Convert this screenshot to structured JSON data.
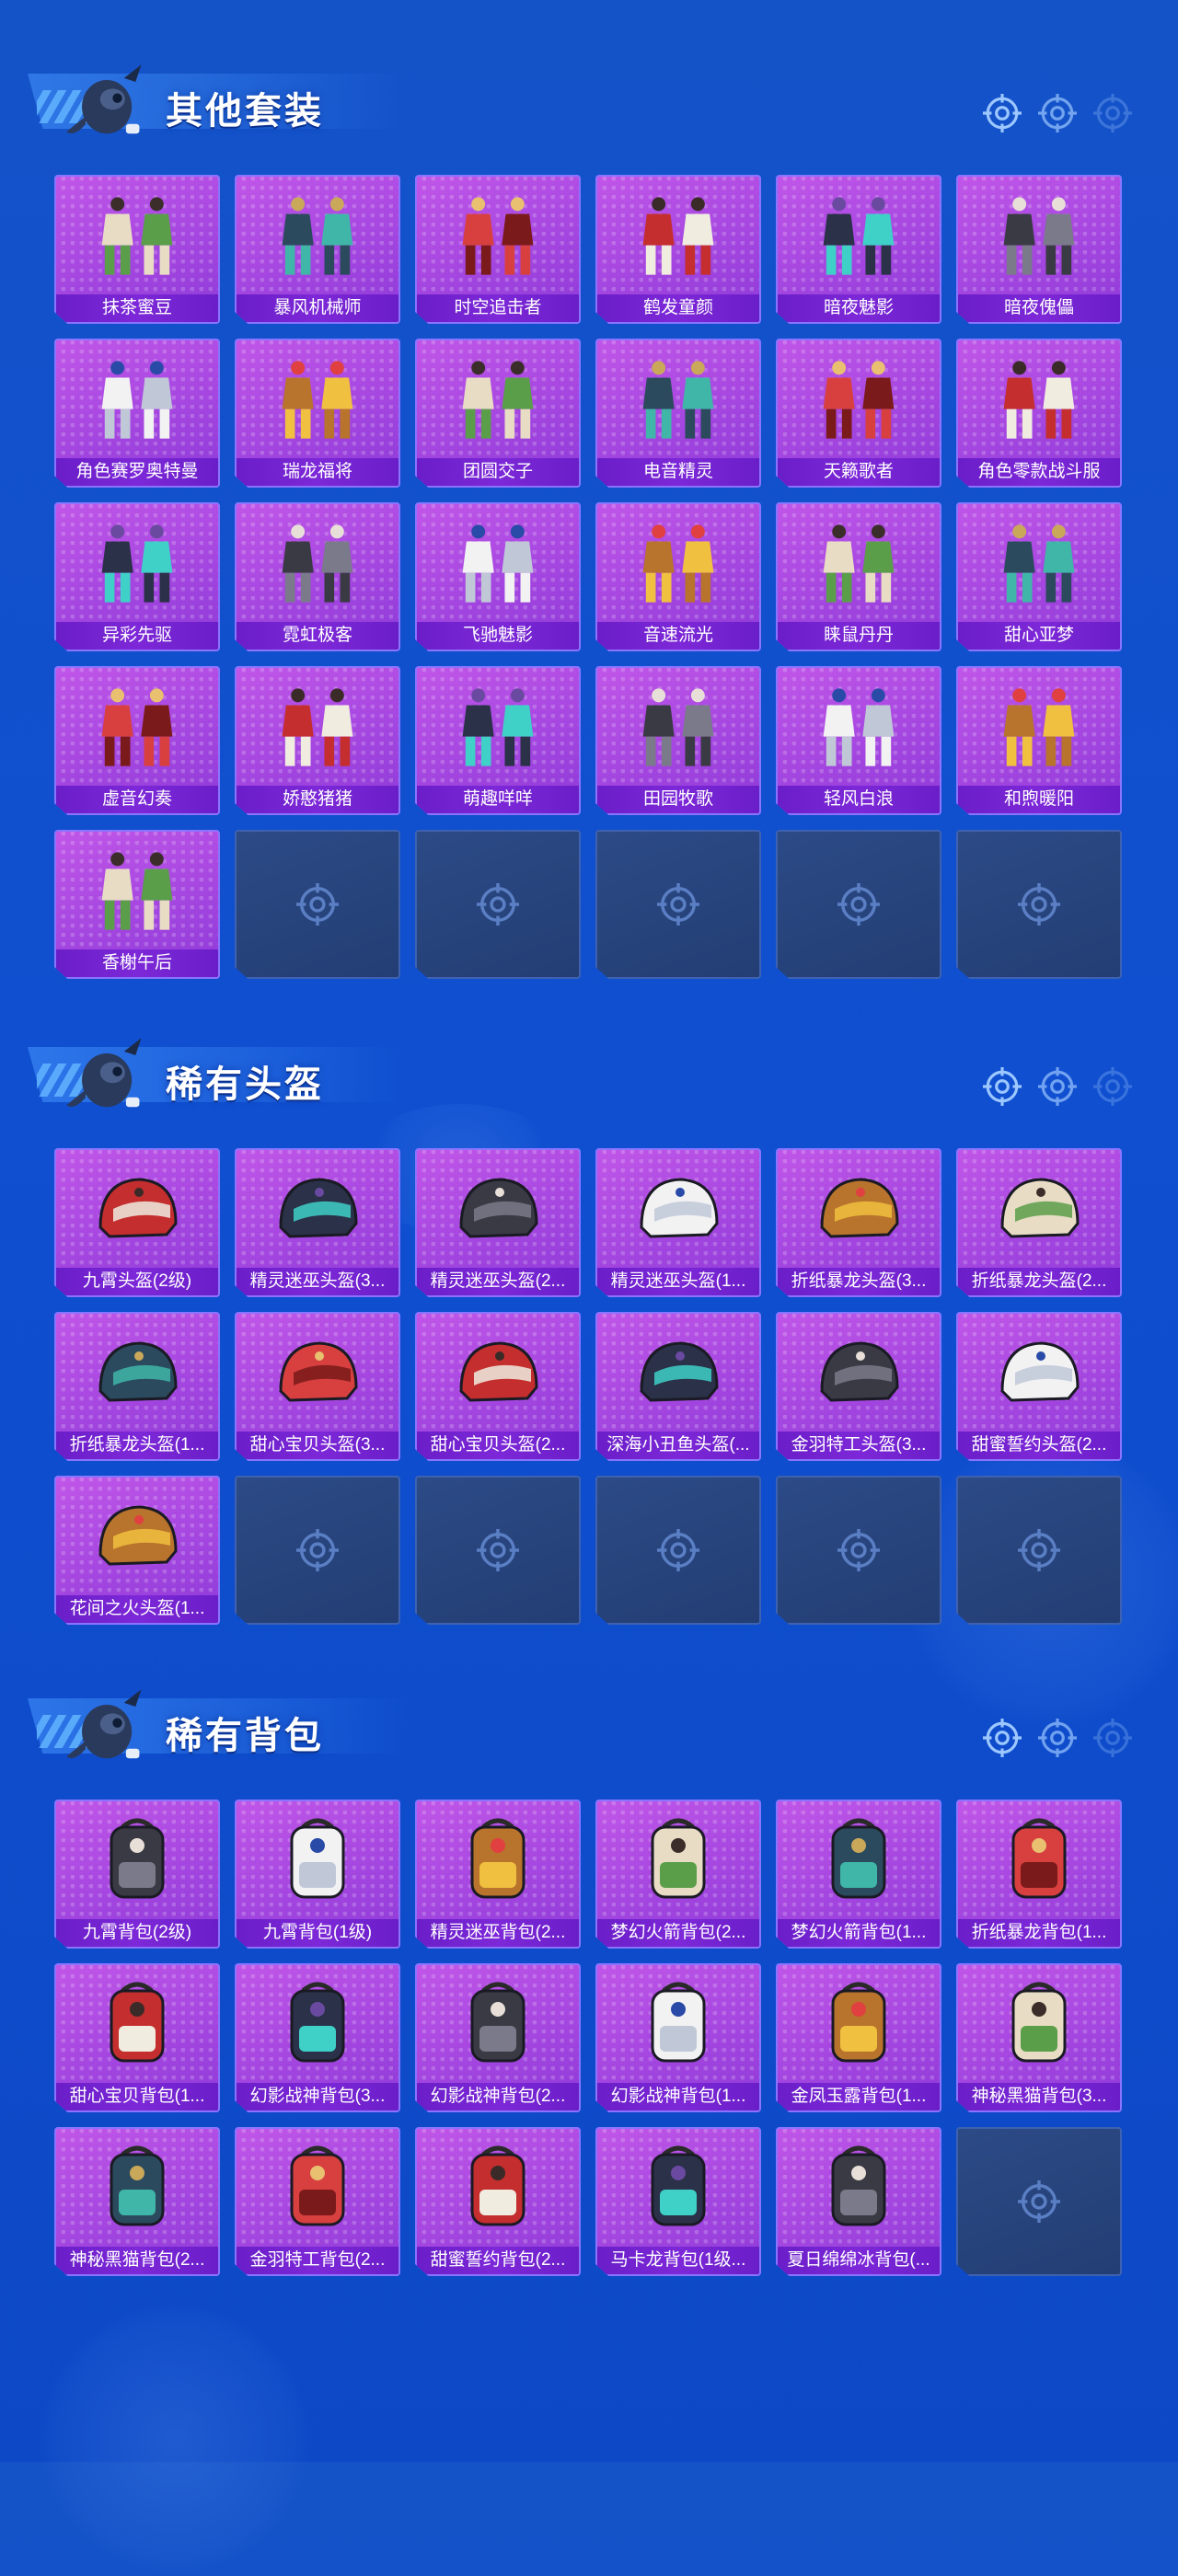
{
  "colors": {
    "background": "#1250cc",
    "card_purple": "#a446e0",
    "card_label": "#6a1ec8",
    "empty_slot": "#233e74"
  },
  "sections": [
    {
      "title": "其他套装",
      "item_icon": "outfit-icon",
      "items": [
        "抹茶蜜豆",
        "暴风机械师",
        "时空追击者",
        "鹤发童颜",
        "暗夜魅影",
        "暗夜傀儡",
        "角色赛罗奥特曼",
        "瑞龙福将",
        "团圆交子",
        "电音精灵",
        "天籁歌者",
        "角色零款战斗服",
        "异彩先驱",
        "霓虹极客",
        "飞驰魅影",
        "音速流光",
        "睐鼠丹丹",
        "甜心亚梦",
        "虚音幻奏",
        "娇憨猪猪",
        "萌趣咩咩",
        "田园牧歌",
        "轻风白浪",
        "和煦暖阳",
        "香榭午后"
      ],
      "empty_slots": 5
    },
    {
      "title": "稀有头盔",
      "item_icon": "helmet-icon",
      "items": [
        "九霄头盔(2级)",
        "精灵迷巫头盔(3...",
        "精灵迷巫头盔(2...",
        "精灵迷巫头盔(1...",
        "折纸暴龙头盔(3...",
        "折纸暴龙头盔(2...",
        "折纸暴龙头盔(1...",
        "甜心宝贝头盔(3...",
        "甜心宝贝头盔(2...",
        "深海小丑鱼头盔(...",
        "金羽特工头盔(3...",
        "甜蜜誓约头盔(2...",
        "花间之火头盔(1..."
      ],
      "empty_slots": 5
    },
    {
      "title": "稀有背包",
      "item_icon": "backpack-icon",
      "items": [
        "九霄背包(2级)",
        "九霄背包(1级)",
        "精灵迷巫背包(2...",
        "梦幻火箭背包(2...",
        "梦幻火箭背包(1...",
        "折纸暴龙背包(1...",
        "甜心宝贝背包(1...",
        "幻影战神背包(3...",
        "幻影战神背包(2...",
        "幻影战神背包(1...",
        "金凤玉露背包(1...",
        "神秘黑猫背包(3...",
        "神秘黑猫背包(2...",
        "金羽特工背包(2...",
        "甜蜜誓约背包(2...",
        "马卡龙背包(1级...",
        "夏日绵绵冰背包(..."
      ],
      "empty_slots": 1
    }
  ]
}
